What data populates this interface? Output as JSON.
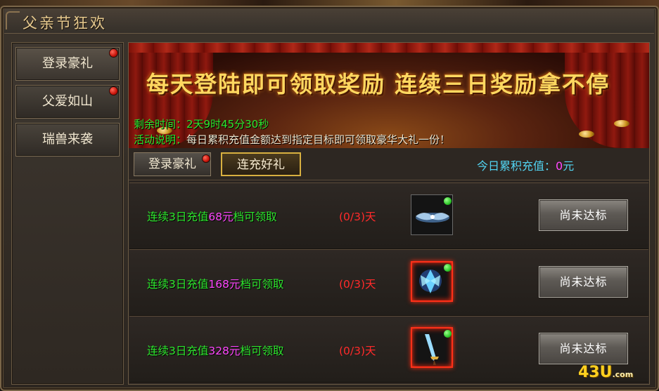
{
  "window": {
    "title": "父亲节狂欢"
  },
  "sidebar": {
    "items": [
      {
        "label": "登录豪礼",
        "badge": true
      },
      {
        "label": "父爱如山",
        "badge": true
      },
      {
        "label": "瑞兽来袭",
        "badge": false
      }
    ]
  },
  "banner": {
    "headline": "每天登陆即可领取奖励 连续三日奖励拿不停",
    "time_label": "剩余时间：",
    "time_value": "2天9时45分30秒",
    "desc_label": "活动说明：",
    "desc_value": "每日累积充值金额达到指定目标即可领取豪华大礼一份！"
  },
  "tabs": [
    {
      "label": "登录豪礼",
      "badge": true,
      "active": false
    },
    {
      "label": "连充好礼",
      "badge": false,
      "active": true
    }
  ],
  "today_recharge": {
    "label": "今日累积充值：",
    "amount": "0",
    "unit": "元"
  },
  "rewards": [
    {
      "prefix": "连续3日充值",
      "amount": "68元",
      "suffix": "档可领取",
      "progress": "(0/3)天",
      "status": "尚未达标",
      "item_icon": "wing-gem-icon"
    },
    {
      "prefix": "连续3日充值",
      "amount": "168元",
      "suffix": "档可领取",
      "progress": "(0/3)天",
      "status": "尚未达标",
      "item_icon": "crystal-wings-icon"
    },
    {
      "prefix": "连续3日充值",
      "amount": "328元",
      "suffix": "档可领取",
      "progress": "(0/3)天",
      "status": "尚未达标",
      "item_icon": "sword-icon"
    }
  ],
  "watermark": {
    "main": "43U",
    "sub": ".com"
  },
  "colors": {
    "gold": "#ffd860",
    "green": "#2ee82e",
    "magenta": "#ff48ff",
    "red": "#ff2a2a",
    "cyan": "#52d4f2"
  }
}
